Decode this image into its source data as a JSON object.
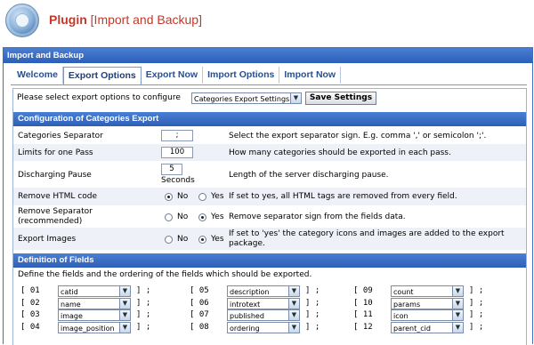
{
  "header": {
    "title": "Plugin",
    "subtitle": "[Import and Backup]"
  },
  "window": {
    "title": "Import and Backup"
  },
  "tabs": [
    {
      "label": "Welcome",
      "active": false
    },
    {
      "label": "Export Options",
      "active": true
    },
    {
      "label": "Export Now",
      "active": false
    },
    {
      "label": "Import Options",
      "active": false
    },
    {
      "label": "Import Now",
      "active": false
    }
  ],
  "selector": {
    "label": "Please select export options to configure",
    "value": "Categories Export Settings",
    "save_label": "Save Settings"
  },
  "config": {
    "title": "Configuration of Categories Export",
    "rows": [
      {
        "name": "Categories Separator",
        "value": ";",
        "desc": "Select the export separator sign. E.g. comma ',' or semicolon ';'."
      },
      {
        "name": "Limits for one Pass",
        "value": "100",
        "desc": "How many categories should be exported in each pass."
      },
      {
        "name": "Discharging Pause",
        "value": "5",
        "unit": "Seconds",
        "desc": "Length of the server discharging pause."
      },
      {
        "name": "Remove HTML code",
        "selected": "No",
        "desc": "If set to yes, all HTML tags are removed from every field."
      },
      {
        "name": "Remove Separator (recommended)",
        "selected": "Yes",
        "desc": "Remove separator sign from the fields data."
      },
      {
        "name": "Export Images",
        "selected": "Yes",
        "desc": "If set to 'yes' the category icons and images are added to the export package."
      }
    ],
    "radio_no": "No",
    "radio_yes": "Yes"
  },
  "fields": {
    "title": "Definition of Fields",
    "intro": "Define the fields and the ordering of the fields which should be exported.",
    "items": [
      {
        "num": "01",
        "value": "catid"
      },
      {
        "num": "02",
        "value": "name"
      },
      {
        "num": "03",
        "value": "image"
      },
      {
        "num": "04",
        "value": "image_position"
      },
      {
        "num": "05",
        "value": "description"
      },
      {
        "num": "06",
        "value": "introtext"
      },
      {
        "num": "07",
        "value": "published"
      },
      {
        "num": "08",
        "value": "ordering"
      },
      {
        "num": "09",
        "value": "count"
      },
      {
        "num": "10",
        "value": "params"
      },
      {
        "num": "11",
        "value": "icon"
      },
      {
        "num": "12",
        "value": "parent_cid"
      }
    ]
  }
}
